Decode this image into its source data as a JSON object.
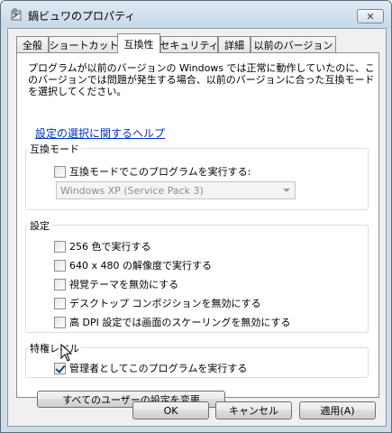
{
  "window": {
    "title": "鍋ビュワのプロパティ",
    "close_symbol": "✕"
  },
  "tabs": [
    {
      "label": "全般",
      "active": false
    },
    {
      "label": "ショートカット",
      "active": false
    },
    {
      "label": "互換性",
      "active": true
    },
    {
      "label": "セキュリティ",
      "active": false
    },
    {
      "label": "詳細",
      "active": false
    },
    {
      "label": "以前のバージョン",
      "active": false
    }
  ],
  "compat": {
    "description": "プログラムが以前のバージョンの Windows では正常に動作していたのに、このバージョンでは問題が発生する場合、以前のバージョンに合った互換モードを選択してください。",
    "help_link": "設定の選択に関するヘルプ",
    "compat_mode": {
      "group_title": "互換モード",
      "checkbox_label": "互換モードでこのプログラムを実行する:",
      "checked": false,
      "dropdown_value": "Windows XP (Service Pack 3)"
    },
    "settings": {
      "group_title": "設定",
      "items": [
        {
          "label": "256 色で実行する",
          "checked": false
        },
        {
          "label": "640 x 480 の解像度で実行する",
          "checked": false
        },
        {
          "label": "視覚テーマを無効にする",
          "checked": false
        },
        {
          "label": "デスクトップ コンポジションを無効にする",
          "checked": false
        },
        {
          "label": "高 DPI 設定では画面のスケーリングを無効にする",
          "checked": false
        }
      ]
    },
    "privilege": {
      "group_title": "特権レベル",
      "checkbox_label": "管理者としてこのプログラムを実行する",
      "checked": true
    },
    "all_users_button": "すべてのユーザーの設定を変更"
  },
  "buttons": {
    "ok": "OK",
    "cancel": "キャンセル",
    "apply": "適用(A)"
  }
}
